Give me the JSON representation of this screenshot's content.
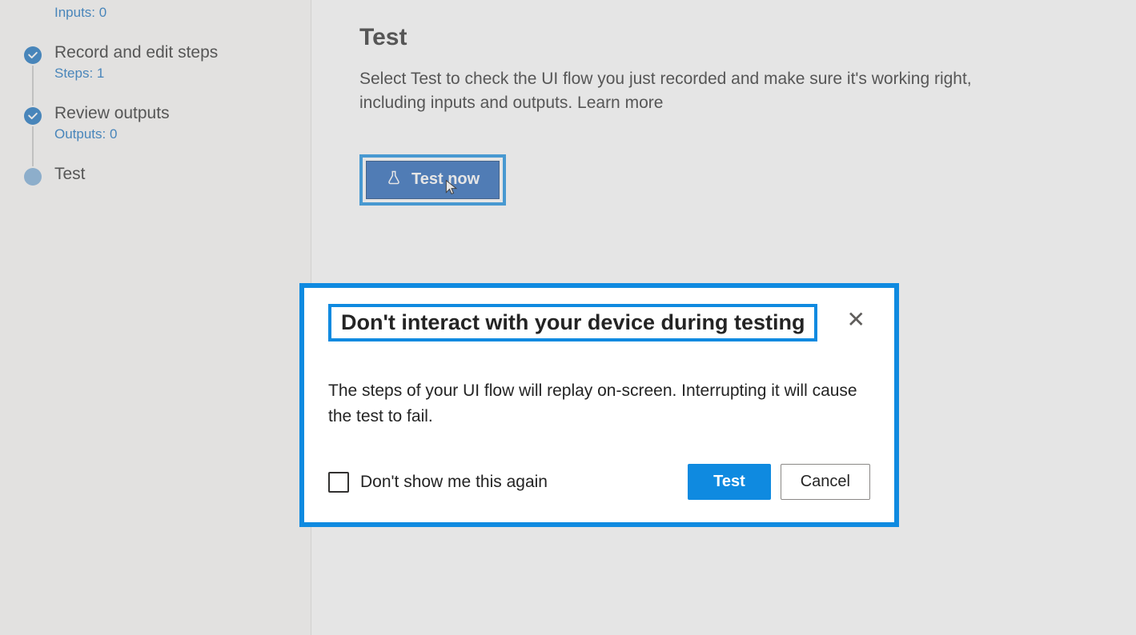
{
  "sidebar": {
    "top_sub": "Inputs: 0",
    "steps": [
      {
        "title": "Record and edit steps",
        "sub": "Steps: 1",
        "state": "done"
      },
      {
        "title": "Review outputs",
        "sub": "Outputs: 0",
        "state": "done"
      },
      {
        "title": "Test",
        "sub": "",
        "state": "current"
      }
    ]
  },
  "main": {
    "title": "Test",
    "description": "Select Test to check the UI flow you just recorded and make sure it's working right, including inputs and outputs. ",
    "learn_more_label": "Learn more",
    "test_now_label": "Test now"
  },
  "dialog": {
    "title": "Don't interact with your device during testing",
    "body": "The steps of your UI flow will replay on-screen. Interrupting it will cause the test to fail.",
    "dont_show_label": "Don't show me this again",
    "test_label": "Test",
    "cancel_label": "Cancel"
  }
}
